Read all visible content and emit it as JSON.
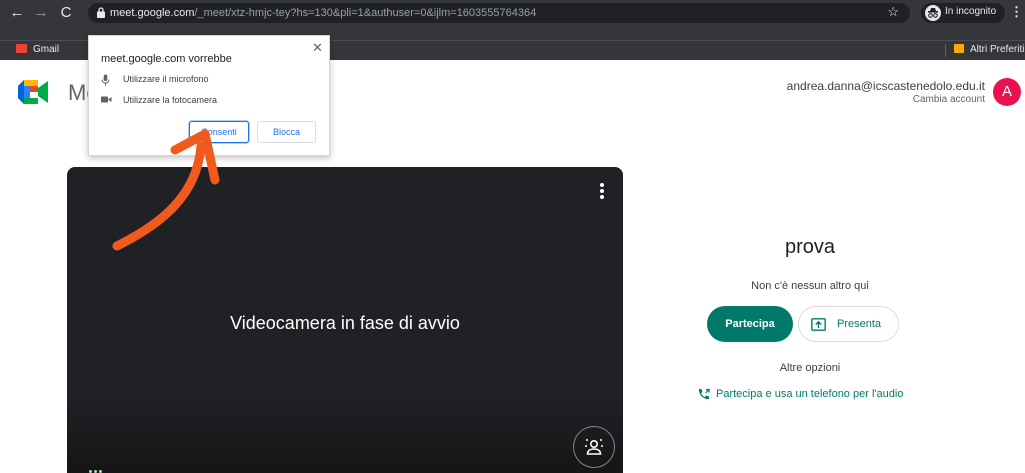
{
  "browser": {
    "url_host": "meet.google.com",
    "url_path": "/_meet/xtz-hmjc-tey?hs=130&pli=1&authuser=0&ijlm=1603555764364",
    "incognito_label": "In incognito",
    "bookmarks": [
      {
        "label": "Gmail",
        "icon": "gmail-icon"
      }
    ],
    "other_bookmarks_label": "Altri Preferiti"
  },
  "permission_popup": {
    "title": "meet.google.com vorrebbe",
    "items": [
      {
        "label": "Utilizzare il microfono",
        "icon": "microphone-icon"
      },
      {
        "label": "Utilizzare la fotocamera",
        "icon": "camera-icon"
      }
    ],
    "allow_label": "Consenti",
    "block_label": "Blocca"
  },
  "header": {
    "app_name": "Meet",
    "account_email": "andrea.danna@icscastenedolo.edu.it",
    "switch_account": "Cambia account",
    "avatar_letter": "A"
  },
  "preview": {
    "status_text": "Videocamera in fase di avvio"
  },
  "join_panel": {
    "meeting_name": "prova",
    "participants_text": "Non c'è nessun altro qui",
    "join_label": "Partecipa",
    "present_label": "Presenta",
    "other_options_label": "Altre opzioni",
    "phone_join_label": "Partecipa e usa un telefono per l'audio"
  },
  "colors": {
    "accent": "#00796b",
    "avatar": "#e8134e",
    "annotation_arrow": "#f15a1d"
  }
}
